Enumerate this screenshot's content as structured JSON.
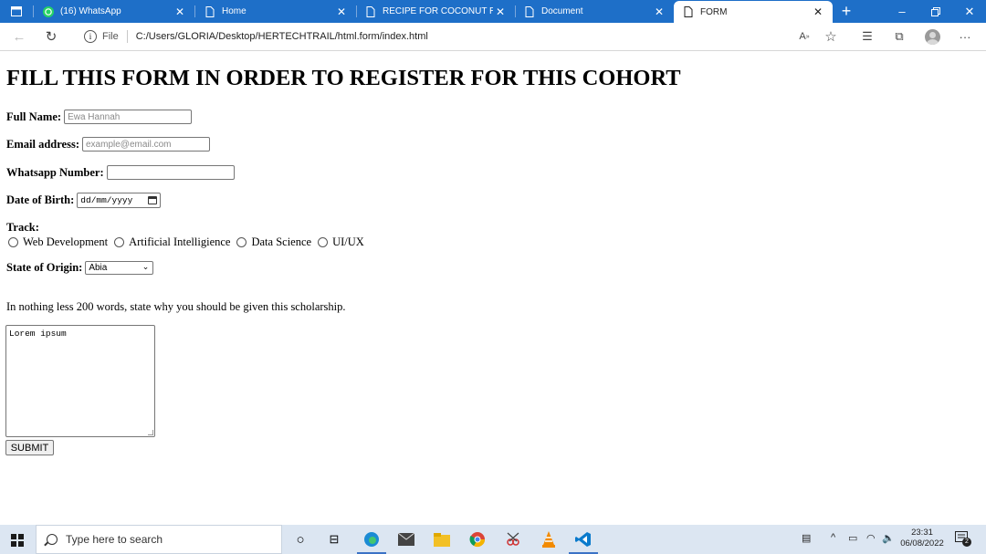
{
  "browser": {
    "tabs": [
      {
        "label": "(16) WhatsApp",
        "icon": "whatsapp-icon",
        "active": false
      },
      {
        "label": "Home",
        "icon": "page-icon",
        "active": false
      },
      {
        "label": "RECIPE FOR COCONUT RECIP",
        "icon": "page-icon",
        "active": false
      },
      {
        "label": "Document",
        "icon": "page-icon",
        "active": false
      },
      {
        "label": "FORM",
        "icon": "page-icon",
        "active": true
      }
    ],
    "address": {
      "scheme": "File",
      "url": "C:/Users/GLORIA/Desktop/HERTECHTRAIL/html.form/index.html"
    },
    "accent_color": "#1e6fc8"
  },
  "form": {
    "heading": "FILL THIS FORM IN ORDER TO REGISTER FOR THIS COHORT",
    "full_name": {
      "label": "Full Name:",
      "placeholder": "Ewa Hannah"
    },
    "email": {
      "label": "Email address:",
      "placeholder": "example@email.com"
    },
    "whatsapp": {
      "label": "Whatsapp Number:",
      "value": ""
    },
    "dob": {
      "label": "Date of Birth:",
      "placeholder": "dd/mm/yyyy"
    },
    "track": {
      "label": "Track:",
      "options": [
        "Web Development",
        "Artificial Intelligience",
        "Data Science",
        "UI/UX"
      ]
    },
    "state": {
      "label": "State of Origin:",
      "selected": "Abia"
    },
    "essay_prompt": "In nothing less 200 words, state why you should be given this scholarship.",
    "essay_value": "Lorem ipsum",
    "submit_label": "SUBMIT"
  },
  "taskbar": {
    "search_placeholder": "Type here to search",
    "time": "23:31",
    "date": "06/08/2022",
    "notification_count": "2"
  }
}
